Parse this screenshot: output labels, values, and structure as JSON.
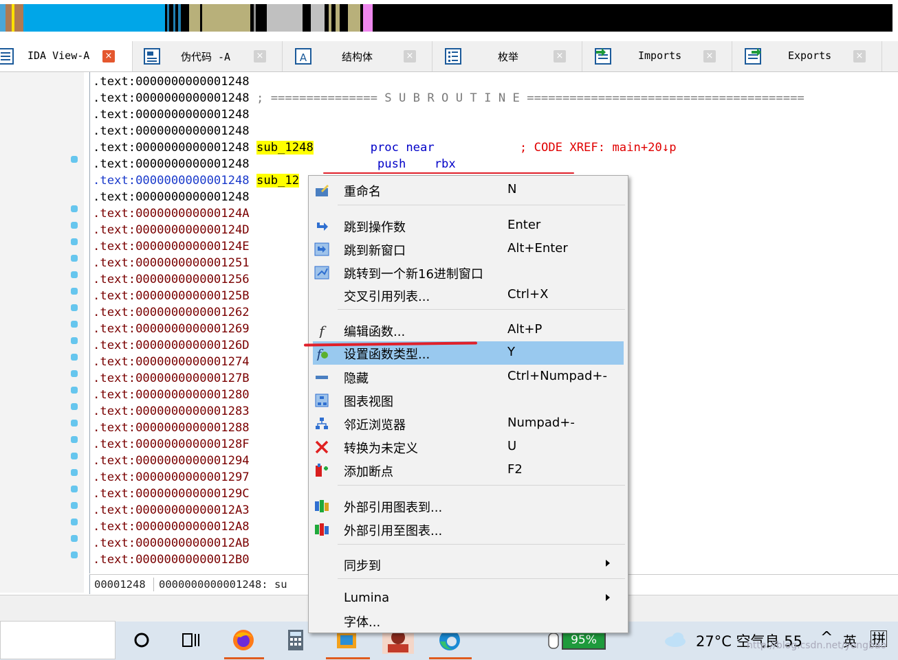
{
  "tabs": [
    {
      "label": "IDA View-A",
      "active": true,
      "icon": "listing-icon",
      "close": "×"
    },
    {
      "label": "伪代码 -A",
      "active": false,
      "icon": "pseudocode-icon",
      "close": "×"
    },
    {
      "label": "结构体",
      "active": false,
      "icon": "structures-icon",
      "close": "×"
    },
    {
      "label": "枚举",
      "active": false,
      "icon": "enums-icon",
      "close": "×"
    },
    {
      "label": "Imports",
      "active": false,
      "icon": "imports-icon",
      "close": "×"
    },
    {
      "label": "Exports",
      "active": false,
      "icon": "exports-icon",
      "close": "×"
    }
  ],
  "listing": {
    "lines": [
      {
        "addr": ".text:0000000000001248",
        "text": ""
      },
      {
        "addr": ".text:0000000000001248",
        "text": " ; =============== S U B R O U T I N E ======================================="
      },
      {
        "addr": ".text:0000000000001248",
        "text": ""
      },
      {
        "addr": ".text:0000000000001248",
        "text": ""
      },
      {
        "addr": ".text:0000000000001248",
        "label": "sub_1248",
        "mid": "        proc near",
        "comment": "; CODE XREF: main+20↓p"
      },
      {
        "addr": ".text:0000000000001248",
        "mid": "                  push    rbx"
      },
      {
        "addr": ".text:0000000000001248",
        "label": "sub_12"
      },
      {
        "addr": ".text:0000000000001248",
        "text": ""
      },
      {
        "addr": ".text:000000000000124A"
      },
      {
        "addr": ".text:000000000000124D"
      },
      {
        "addr": ".text:000000000000124E"
      },
      {
        "addr": ".text:0000000000001251"
      },
      {
        "addr": ".text:0000000000001256"
      },
      {
        "addr": ".text:000000000000125B"
      },
      {
        "addr": ".text:0000000000001262"
      },
      {
        "addr": ".text:0000000000001269"
      },
      {
        "addr": ".text:000000000000126D"
      },
      {
        "addr": ".text:0000000000001274"
      },
      {
        "addr": ".text:000000000000127B"
      },
      {
        "addr": ".text:0000000000001280"
      },
      {
        "addr": ".text:0000000000001283"
      },
      {
        "addr": ".text:0000000000001288"
      },
      {
        "addr": ".text:000000000000128F"
      },
      {
        "addr": ".text:0000000000001294"
      },
      {
        "addr": ".text:0000000000001297"
      },
      {
        "addr": ".text:000000000000129C"
      },
      {
        "addr": ".text:00000000000012A3"
      },
      {
        "addr": ".text:00000000000012A8"
      },
      {
        "addr": ".text:00000000000012AB"
      },
      {
        "addr": ".text:00000000000012B0"
      }
    ]
  },
  "status": {
    "offset": "00001248",
    "location": "0000000000001248: su"
  },
  "context_menu": {
    "items": [
      {
        "label": "重命名",
        "shortcut": "N",
        "icon": "rename-icon"
      },
      {
        "label": "跳到操作数",
        "shortcut": "Enter",
        "icon": "jump-operand-icon"
      },
      {
        "label": "跳到新窗口",
        "shortcut": "Alt+Enter",
        "icon": "jump-new-window-icon"
      },
      {
        "label": "跳转到一个新16进制窗口",
        "shortcut": "",
        "icon": "hex-window-icon"
      },
      {
        "label": "交叉引用列表...",
        "shortcut": "Ctrl+X",
        "icon": ""
      },
      {
        "label": "编辑函数...",
        "shortcut": "Alt+P",
        "icon": "function-icon"
      },
      {
        "label": "设置函数类型...",
        "shortcut": "Y",
        "icon": "function-type-icon",
        "highlighted": true
      },
      {
        "label": "隐藏",
        "shortcut": "Ctrl+Numpad+-",
        "icon": "hide-icon"
      },
      {
        "label": "图表视图",
        "shortcut": "",
        "icon": "graph-view-icon"
      },
      {
        "label": "邻近浏览器",
        "shortcut": "Numpad+-",
        "icon": "proximity-browser-icon"
      },
      {
        "label": "转换为未定义",
        "shortcut": "U",
        "icon": "undefine-icon"
      },
      {
        "label": "添加断点",
        "shortcut": "F2",
        "icon": "breakpoint-icon"
      },
      {
        "label": "外部引用图表到...",
        "shortcut": "",
        "icon": "xref-graph-to-icon"
      },
      {
        "label": "外部引用至图表...",
        "shortcut": "",
        "icon": "xref-graph-from-icon"
      },
      {
        "label": "同步到",
        "shortcut": "",
        "icon": "",
        "submenu": true
      },
      {
        "label": "Lumina",
        "shortcut": "",
        "icon": "",
        "submenu": true
      },
      {
        "label": "字体...",
        "shortcut": "",
        "icon": ""
      }
    ]
  },
  "taskbar": {
    "battery": "95%",
    "weather": "27°C  空气良 55",
    "ime": "英",
    "ime2": "拼",
    "watermark": "http://blog.csdn.net/yongbao"
  },
  "colors": {
    "accent_selected": "#99c9ef",
    "label_highlight": "#ffff00",
    "annotation_red": "#e0202a"
  }
}
